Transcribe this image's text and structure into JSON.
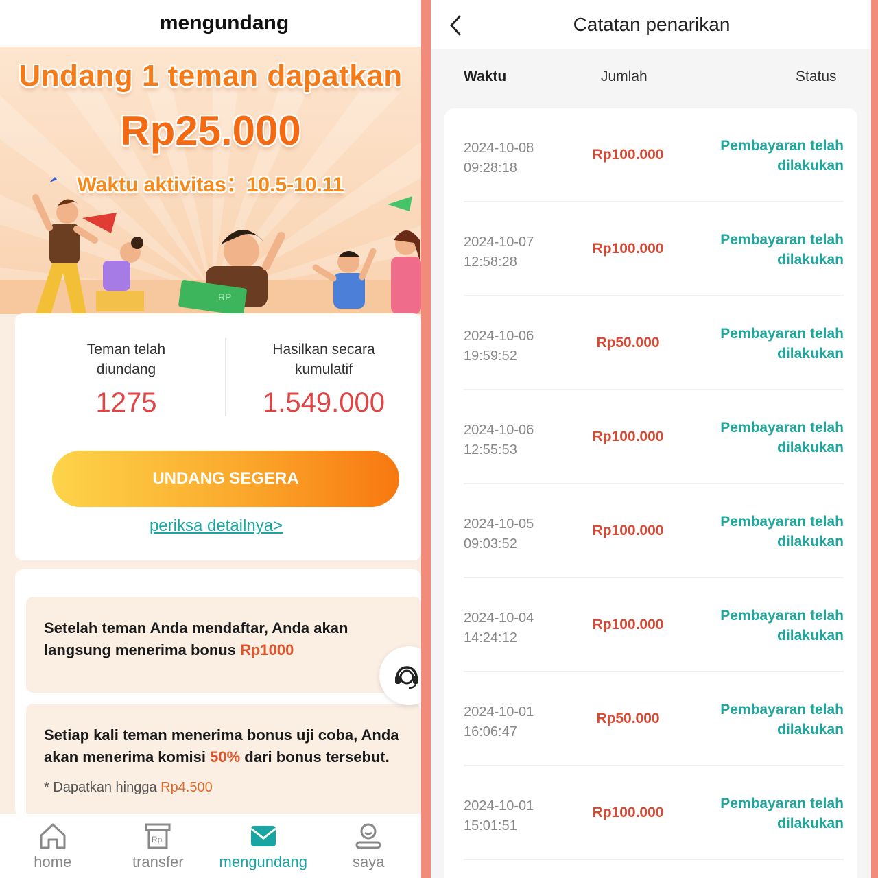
{
  "left": {
    "title": "mengundang",
    "banner": {
      "headline": "Undang 1 teman dapatkan",
      "amount": "Rp25.000",
      "period": "Waktu aktivitas：10.5-10.11",
      "money_label": "RP"
    },
    "stats": {
      "invited_label_1": "Teman telah",
      "invited_label_2": "diundang",
      "invited_value": "1275",
      "earned_label_1": "Hasilkan secara",
      "earned_label_2": "kumulatif",
      "earned_value": "1.549.000"
    },
    "invite_button": "UNDANG SEGERA",
    "details_link": "periksa detailnya>",
    "rules": [
      {
        "text_a": "Setelah teman Anda mendaftar, Anda akan langsung menerima bonus ",
        "highlight": "Rp1000"
      },
      {
        "text_a": "Setiap kali teman menerima bonus uji coba, Anda akan menerima komisi ",
        "highlight": "50%",
        "text_b": " dari bonus tersebut.",
        "note_a": "* Dapatkan hingga ",
        "note_highlight": "Rp4.500"
      }
    ],
    "tabs": [
      {
        "label": "home",
        "icon": "home-icon",
        "active": false
      },
      {
        "label": "transfer",
        "icon": "transfer-icon",
        "active": false
      },
      {
        "label": "mengundang",
        "icon": "invite-icon",
        "active": true
      },
      {
        "label": "saya",
        "icon": "profile-icon",
        "active": false
      }
    ]
  },
  "right": {
    "title": "Catatan penarikan",
    "columns": [
      "Waktu",
      "Jumlah",
      "Status"
    ],
    "records": [
      {
        "date": "2024-10-08",
        "time": "09:28:18",
        "amount": "Rp100.000",
        "status_1": "Pembayaran telah",
        "status_2": "dilakukan"
      },
      {
        "date": "2024-10-07",
        "time": "12:58:28",
        "amount": "Rp100.000",
        "status_1": "Pembayaran telah",
        "status_2": "dilakukan"
      },
      {
        "date": "2024-10-06",
        "time": "19:59:52",
        "amount": "Rp50.000",
        "status_1": "Pembayaran telah",
        "status_2": "dilakukan"
      },
      {
        "date": "2024-10-06",
        "time": "12:55:53",
        "amount": "Rp100.000",
        "status_1": "Pembayaran telah",
        "status_2": "dilakukan"
      },
      {
        "date": "2024-10-05",
        "time": "09:03:52",
        "amount": "Rp100.000",
        "status_1": "Pembayaran telah",
        "status_2": "dilakukan"
      },
      {
        "date": "2024-10-04",
        "time": "14:24:12",
        "amount": "Rp100.000",
        "status_1": "Pembayaran telah",
        "status_2": "dilakukan"
      },
      {
        "date": "2024-10-01",
        "time": "16:06:47",
        "amount": "Rp50.000",
        "status_1": "Pembayaran telah",
        "status_2": "dilakukan"
      },
      {
        "date": "2024-10-01",
        "time": "15:01:51",
        "amount": "Rp100.000",
        "status_1": "Pembayaran telah",
        "status_2": "dilakukan"
      }
    ]
  },
  "colors": {
    "accent_teal": "#19a6a3",
    "amount_red": "#d54b36",
    "stat_red": "#e04444",
    "button_orange": "#fba82c",
    "divider_salmon": "#f28b7a"
  }
}
